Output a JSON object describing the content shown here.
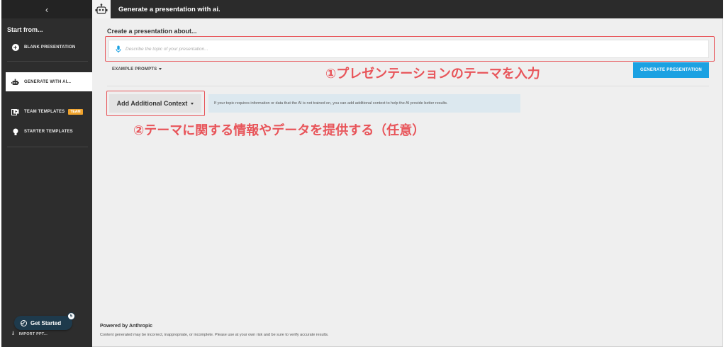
{
  "sidebar": {
    "back_icon": "chevron-left-icon",
    "title": "Start from...",
    "items": [
      {
        "label": "BLANK PRESENTATION",
        "icon": "plus-circle-icon"
      },
      {
        "label": "GENERATE WITH AI...",
        "icon": "robot-icon",
        "active": true
      },
      {
        "label": "TEAM TEMPLATES",
        "icon": "template-icon",
        "badge": "TEAM"
      },
      {
        "label": "STARTER TEMPLATES",
        "icon": "lightbulb-icon"
      }
    ],
    "get_started": {
      "label": "Get Started",
      "count": "5"
    },
    "import_label": "IMPORT PPT..."
  },
  "header": {
    "title": "Generate a presentation with ai.",
    "icon": "robot-icon"
  },
  "main": {
    "label": "Create a presentation about...",
    "topic_placeholder": "Describe the topic of your presentation...",
    "example_prompts": "EXAMPLE PROMPTS",
    "generate_button": "GENERATE PRESENTATION",
    "context_button": "Add Additional Context",
    "context_note": "If your topic requires information or data that the AI is not trained on, you can add additional context to help the AI provide better results."
  },
  "annotations": {
    "step1": "①プレゼンテーションのテーマを入力",
    "step2": "②テーマに関する情報やデータを提供する（任意）"
  },
  "footer": {
    "powered_by": "Powered by Anthropic",
    "disclaimer": "Content generated may be incorrect, inappropriate, or incomplete. Please use at your own risk and be sure to verify accurate results."
  },
  "colors": {
    "sidebar_bg": "#2d2d2d",
    "accent_blue": "#1ba1e2",
    "annotation_red": "#e8555a",
    "badge_orange": "#f0a32c"
  }
}
